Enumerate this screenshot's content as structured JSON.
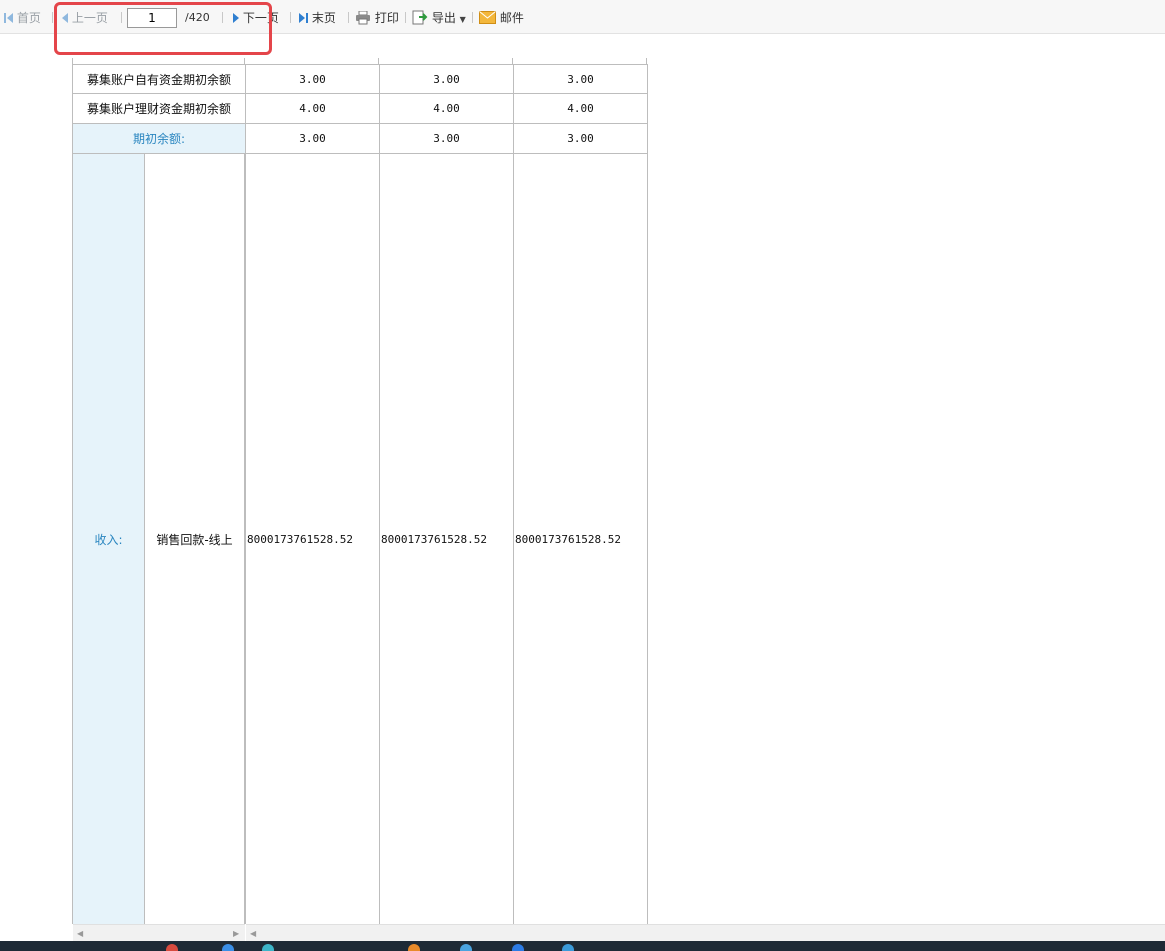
{
  "toolbar": {
    "first_label": "首页",
    "prev_label": "上一页",
    "page_current": "1",
    "page_total": "/420",
    "next_label": "下一页",
    "last_label": "末页",
    "print_label": "打印",
    "export_label": "导出",
    "mail_label": "邮件"
  },
  "report": {
    "rows": [
      {
        "label": "募集账户自有资金期初余额",
        "values": [
          "3.00",
          "3.00",
          "3.00"
        ]
      },
      {
        "label": "募集账户理财资金期初余额",
        "values": [
          "4.00",
          "4.00",
          "4.00"
        ]
      }
    ],
    "opening_balance": {
      "label": "期初余额:",
      "values": [
        "3.00",
        "3.00",
        "3.00"
      ]
    },
    "income": {
      "group_label": "收入:",
      "item_label": "销售回款-线上",
      "values": [
        "8000173761528.52",
        "8000173761528.52",
        "8000173761528.52"
      ]
    }
  },
  "colors": {
    "highlight_border": "#e4454a",
    "header_cell_bg": "#e6f3fa",
    "header_text": "#2a86c0",
    "nav_blue": "#2f7fd0"
  }
}
